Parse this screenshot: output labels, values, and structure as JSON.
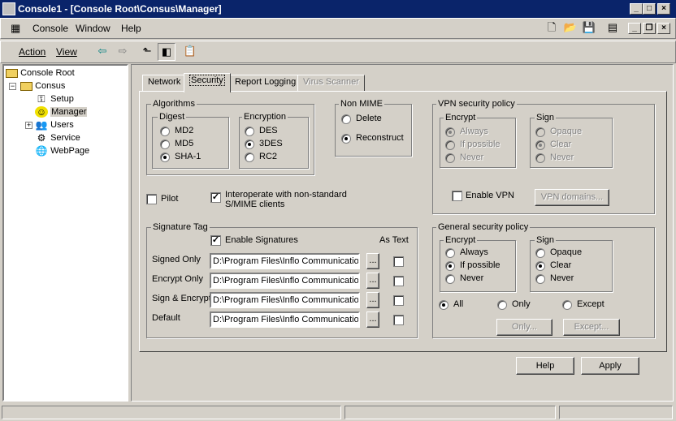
{
  "window": {
    "title": "Console1 - [Console Root\\Consus\\Manager]",
    "min": "_",
    "max": "□",
    "close": "×"
  },
  "menu": {
    "console": "Console",
    "window": "Window",
    "help": "Help"
  },
  "mdi": {
    "min": "_",
    "restore": "❐",
    "close": "×"
  },
  "toolbar": {
    "action": "Action",
    "view": "View",
    "back": "⇦",
    "forward": "⇨"
  },
  "tree": {
    "root": "Console Root",
    "consus": "Consus",
    "setup": "Setup",
    "manager": "Manager",
    "users": "Users",
    "service": "Service",
    "webpage": "WebPage"
  },
  "tabs": {
    "network": "Network",
    "security": "Security",
    "report_logging": "Report Logging",
    "virus_scanner": "Virus Scanner"
  },
  "algorithms": {
    "title": "Algorithms",
    "digest": {
      "title": "Digest",
      "options": [
        "MD2",
        "MD5",
        "SHA-1"
      ],
      "selected": "SHA-1"
    },
    "encryption": {
      "title": "Encryption",
      "options": [
        "DES",
        "3DES",
        "RC2"
      ],
      "selected": "3DES"
    }
  },
  "non_mime": {
    "title": "Non MIME",
    "options": [
      "Delete",
      "Reconstruct"
    ],
    "selected": "Reconstruct"
  },
  "vpn": {
    "title": "VPN security policy",
    "encrypt": {
      "title": "Encrypt",
      "options": [
        "Always",
        "If possible",
        "Never"
      ],
      "selected": "Always"
    },
    "sign": {
      "title": "Sign",
      "options": [
        "Opaque",
        "Clear",
        "Never"
      ],
      "selected": "Clear"
    },
    "enable_label": "Enable VPN",
    "domains_button": "VPN domains..."
  },
  "pilot_label": "Pilot",
  "interop_label_1": "Interoperate with non-standard",
  "interop_label_2": "S/MIME clients",
  "signature": {
    "title": "Signature Tag",
    "enable_label": "Enable Signatures",
    "as_text": "As Text",
    "browse": "...",
    "rows": [
      {
        "label": "Signed Only",
        "path": "D:\\Program Files\\Inflo Communication"
      },
      {
        "label": "Encrypt Only",
        "path": "D:\\Program Files\\Inflo Communication"
      },
      {
        "label": "Sign & Encrypt",
        "path": "D:\\Program Files\\Inflo Communication"
      },
      {
        "label": "Default",
        "path": "D:\\Program Files\\Inflo Communication"
      }
    ]
  },
  "general": {
    "title": "General security policy",
    "encrypt": {
      "title": "Encrypt",
      "options": [
        "Always",
        "If possible",
        "Never"
      ],
      "selected": "If possible"
    },
    "sign": {
      "title": "Sign",
      "options": [
        "Opaque",
        "Clear",
        "Never"
      ],
      "selected": "Clear"
    },
    "scope": {
      "options": [
        "All",
        "Only",
        "Except"
      ],
      "selected": "All"
    },
    "only_button": "Only...",
    "except_button": "Except..."
  },
  "buttons": {
    "help": "Help",
    "apply": "Apply"
  }
}
